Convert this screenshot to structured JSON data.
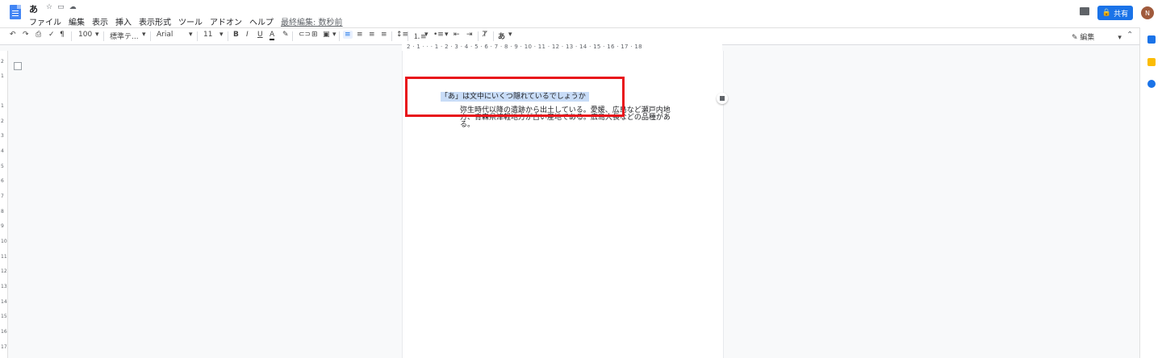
{
  "document": {
    "title": "あ"
  },
  "menu": {
    "items": [
      "ファイル",
      "編集",
      "表示",
      "挿入",
      "表示形式",
      "ツール",
      "アドオン",
      "ヘルプ"
    ],
    "last_edit": "最終編集: 数秒前"
  },
  "header": {
    "share_label": "共有",
    "avatar_initial": "N"
  },
  "toolbar": {
    "zoom": "100",
    "style": "標準テ...",
    "font": "Arial",
    "font_size": "11",
    "bold": "B",
    "italic": "I",
    "underline": "U",
    "text_color": "A",
    "input_tool": "あ",
    "mode_label": "編集"
  },
  "ruler": {
    "labels": "2 · 1 · · · 1 · 2 · 3 · 4 · 5 · 6 · 7 · 8 · 9 · 10 · 11 · 12 · 13 · 14 · 15 · 16 · 17 · 18"
  },
  "vertical_ruler": [
    "2",
    "1",
    "1",
    "2",
    "3",
    "4",
    "5",
    "6",
    "7",
    "8",
    "9",
    "10",
    "11",
    "12",
    "13",
    "14",
    "15",
    "16",
    "17"
  ],
  "content": {
    "selected_line": "「あ」は文中にいくつ隠れているでしょうか",
    "body": "弥生時代以降の遺跡から出土している。愛媛、広島など瀬戸内地方、青森県津軽地方が古い産地である。広島大長などの品種がある。"
  },
  "colors": {
    "accent": "#1a73e8",
    "highlight_box": "#e8141b",
    "selection": "#c8dcf7"
  }
}
